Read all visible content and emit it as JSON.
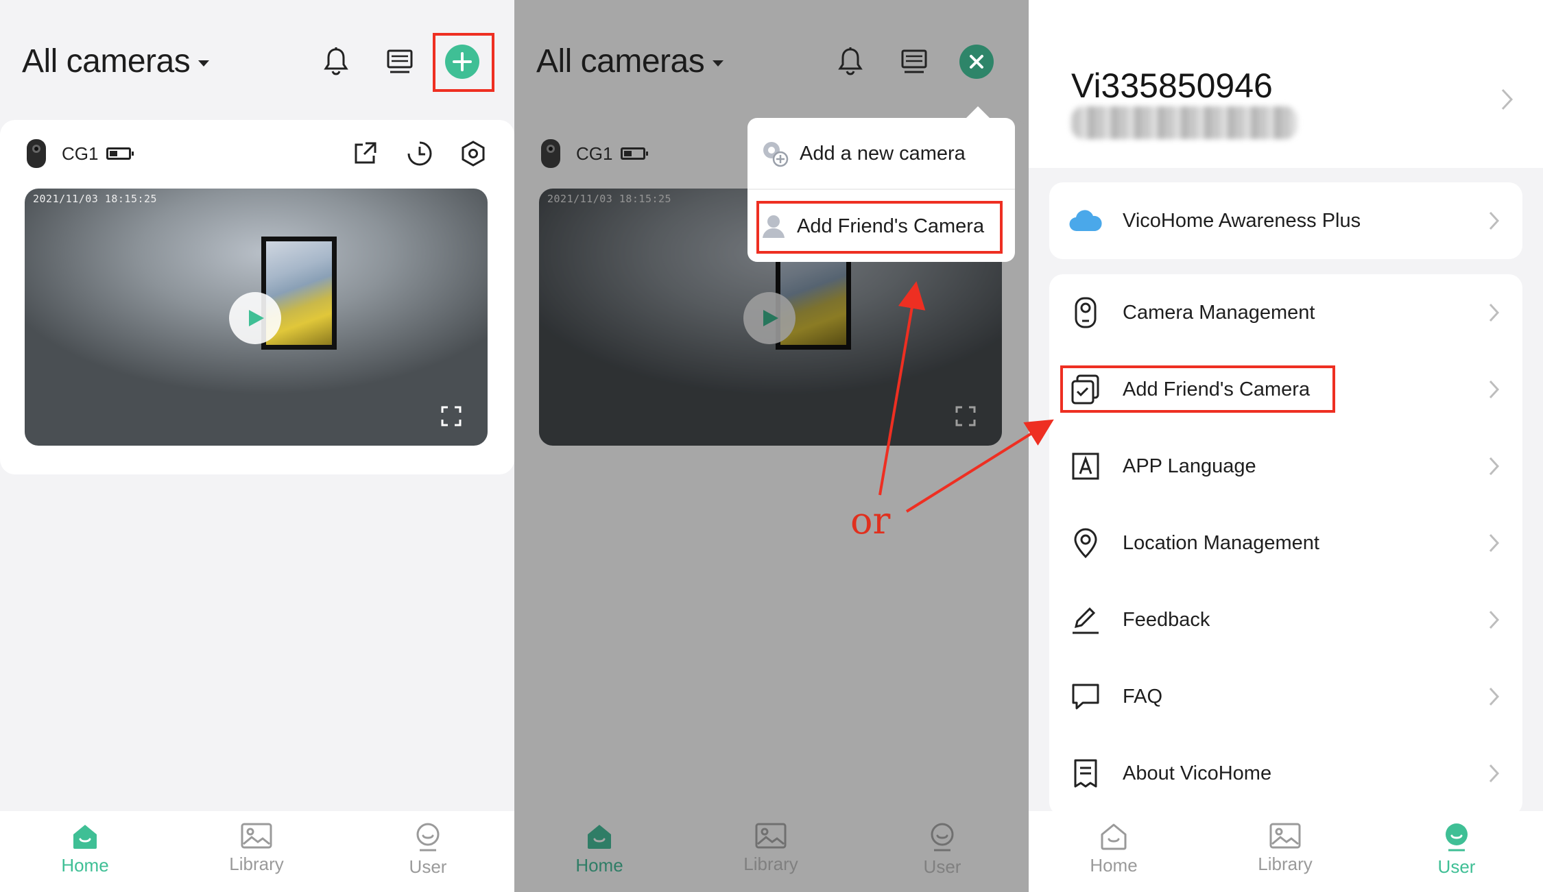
{
  "panel_home": {
    "title": "All cameras",
    "camera": {
      "name": "CG1",
      "timestamp": "2021/11/03 18:15:25"
    },
    "tabs": [
      {
        "label": "Home",
        "active": true
      },
      {
        "label": "Library",
        "active": false
      },
      {
        "label": "User",
        "active": false
      }
    ]
  },
  "panel_menu": {
    "title": "All cameras",
    "camera": {
      "name": "CG1",
      "timestamp": "2021/11/03 18:15:25"
    },
    "popup": {
      "add_new_camera": "Add a new camera",
      "add_friends_camera": "Add Friend's Camera"
    },
    "annotation": "or",
    "tabs": [
      {
        "label": "Home",
        "active": true
      },
      {
        "label": "Library",
        "active": false
      },
      {
        "label": "User",
        "active": false
      }
    ]
  },
  "panel_user": {
    "user_id": "Vi335850946",
    "menu_awareness": "VicoHome Awareness Plus",
    "menu_items": [
      {
        "label": "Camera Management",
        "icon": "camera-outline-icon"
      },
      {
        "label": "Add Friend's Camera",
        "icon": "share-camera-icon"
      },
      {
        "label": "APP Language",
        "icon": "language-icon"
      },
      {
        "label": "Location Management",
        "icon": "location-pin-icon"
      },
      {
        "label": "Feedback",
        "icon": "pencil-icon"
      },
      {
        "label": "FAQ",
        "icon": "chat-bubble-icon"
      },
      {
        "label": "About VicoHome",
        "icon": "document-icon"
      }
    ],
    "tabs": [
      {
        "label": "Home",
        "active": false
      },
      {
        "label": "Library",
        "active": false
      },
      {
        "label": "User",
        "active": true
      }
    ]
  },
  "colors": {
    "accent": "#3fbf95",
    "highlight": "#ee2f22",
    "close_button": "#2e8569"
  }
}
